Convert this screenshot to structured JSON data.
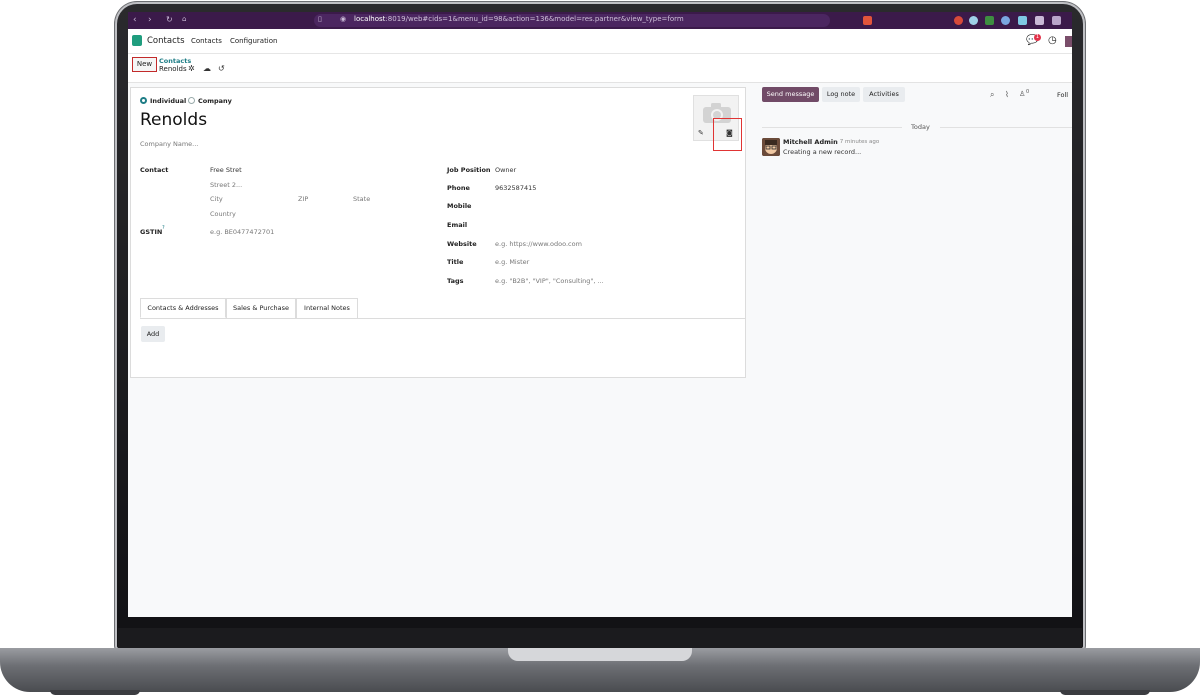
{
  "browser": {
    "url_host": "localhost",
    "url_rest": ":8019/web#cids=1&menu_id=98&action=136&model=res.partner&view_type=form"
  },
  "navbar": {
    "app_name": "Contacts",
    "menu": [
      "Contacts",
      "Configuration"
    ],
    "notification_count": "1"
  },
  "control_panel": {
    "new_label": "New",
    "breadcrumb_parent": "Contacts",
    "breadcrumb_current": "Renolds"
  },
  "form": {
    "type_options": [
      "Individual",
      "Company"
    ],
    "selected_type": "Individual",
    "name": "Renolds",
    "company_placeholder": "Company Name...",
    "left_fields": {
      "contact_label": "Contact",
      "street": "Free Stret",
      "street2_placeholder": "Street 2...",
      "city_placeholder": "City",
      "zip_placeholder": "ZIP",
      "state_placeholder": "State",
      "country_placeholder": "Country",
      "gstin_label": "GSTIN",
      "gstin_help": "?",
      "gstin_placeholder": "e.g. BE0477472701"
    },
    "right_fields": {
      "job_position_label": "Job Position",
      "job_position": "Owner",
      "phone_label": "Phone",
      "phone": "9632587415",
      "mobile_label": "Mobile",
      "email_label": "Email",
      "website_label": "Website",
      "website_placeholder": "e.g. https://www.odoo.com",
      "title_label": "Title",
      "title_placeholder": "e.g. Mister",
      "tags_label": "Tags",
      "tags_placeholder": "e.g. \"B2B\", \"VIP\", \"Consulting\", ..."
    },
    "tabs": [
      "Contacts & Addresses",
      "Sales & Purchase",
      "Internal Notes"
    ],
    "active_tab": "Contacts & Addresses",
    "add_label": "Add"
  },
  "chatter": {
    "send_message": "Send message",
    "log_note": "Log note",
    "activities": "Activities",
    "follower_count": "0",
    "follow_label": "Foll",
    "date_separator": "Today",
    "messages": [
      {
        "author": "Mitchell Admin",
        "time": "- 7 minutes ago",
        "body": "Creating a new record..."
      }
    ]
  },
  "colors": {
    "browser_bar": "#3b1a4a",
    "primary": "#714b67",
    "teal": "#1e7d86",
    "highlight": "#e03434"
  }
}
